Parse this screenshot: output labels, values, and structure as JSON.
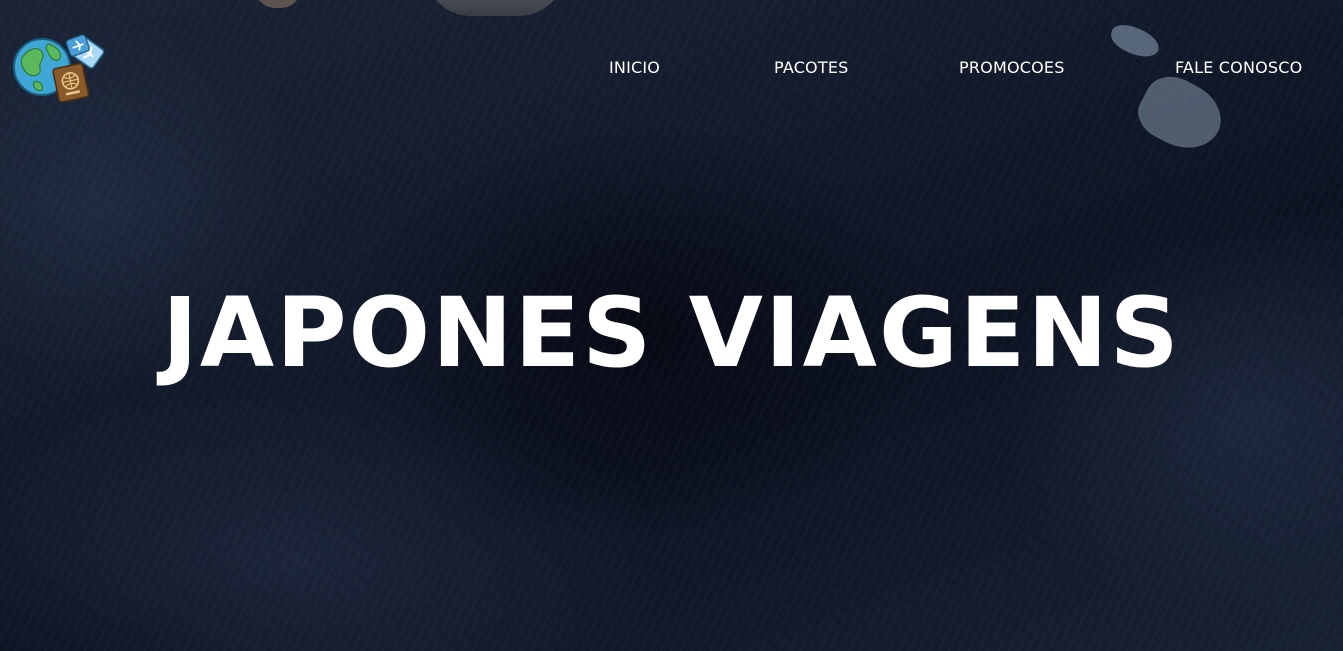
{
  "site": {
    "title": "JAPONES VIAGENS",
    "logo_icon": "globe-passport-plane-icon"
  },
  "nav": {
    "items": [
      {
        "label": "INICIO"
      },
      {
        "label": "PACOTES"
      },
      {
        "label": "PROMOCOES"
      },
      {
        "label": "FALE CONOSCO"
      }
    ]
  },
  "colors": {
    "text": "#ffffff",
    "background": "#121a2b",
    "globe_water": "#3fa7d6",
    "globe_land": "#5cb85c",
    "passport": "#8b5a2b"
  }
}
